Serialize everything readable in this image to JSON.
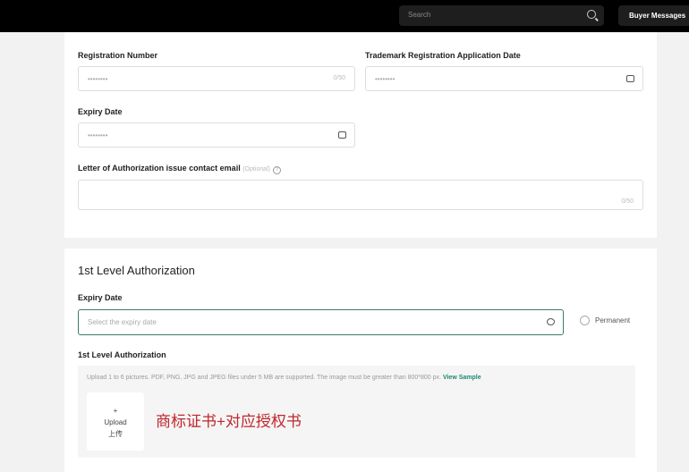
{
  "header": {
    "search_placeholder": "Search",
    "buyer_messages": "Buyer Messages"
  },
  "trademark": {
    "registration_number_label": "Registration Number",
    "registration_number_value": "••••••••",
    "registration_number_counter": "0/50",
    "application_date_label": "Trademark Registration Application Date",
    "application_date_value": "••••••••",
    "expiry_date_label": "Expiry Date",
    "expiry_date_value": "••••••••",
    "email_label": "Letter of Authorization issue contact email",
    "email_optional": "(Optional)",
    "email_counter": "0/50"
  },
  "authorization": {
    "title": "1st Level Authorization",
    "expiry_label": "Expiry Date",
    "expiry_placeholder": "Select the expiry date",
    "permanent_label": "Permanent",
    "upload_label": "1st Level Authorization",
    "upload_hint": "Upload 1 to 6 pictures. PDF, PNG, JPG and JPEG files under 5 MB are supported. The image must be greater than 800*800 px.",
    "view_sample": "View Sample",
    "upload_plus": "+",
    "upload_btn": "Upload",
    "upload_btn_cn": "上传",
    "annotation": "商标证书+对应授权书"
  }
}
